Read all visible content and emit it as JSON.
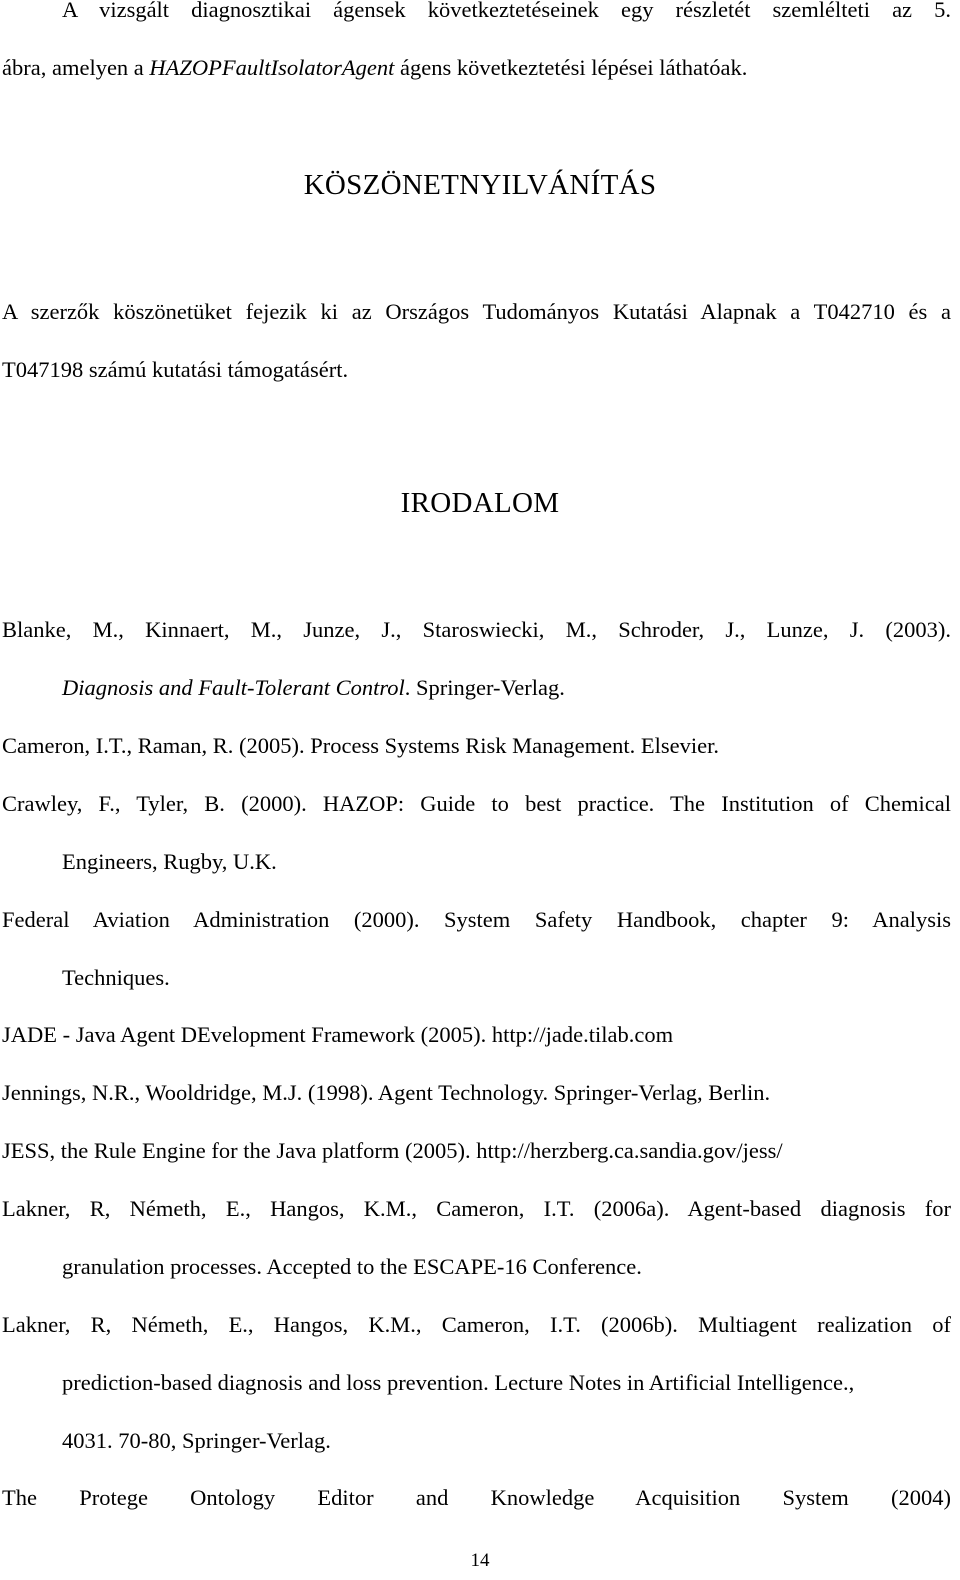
{
  "intro": {
    "line1": "A vizsgált diagnosztikai ágensek következtetéseinek egy részletét szemlélteti az 5.",
    "line2_before": "ábra, amelyen a ",
    "line2_italic": "HAZOPFaultIsolatorAgent",
    "line2_after": " ágens következtetési lépései láthatóak."
  },
  "acknowledgement": {
    "heading": "KÖSZÖNETNYILVÁNÍTÁS",
    "line1": "A szerzők köszönetüket fejezik ki az Országos Tudományos Kutatási Alapnak a T042710 és a",
    "line2": "T047198 számú kutatási támogatásért."
  },
  "references": {
    "heading": "IRODALOM",
    "items": [
      {
        "line1": "Blanke, M., Kinnaert, M., Junze, J., Staroswiecki, M., Schroder, J., Lunze, J. (2003).",
        "line2_italic": "Diagnosis and Fault-Tolerant Control",
        "line2_after": ". Springer-Verlag."
      },
      {
        "line1": "Cameron, I.T., Raman, R. (2005). Process Systems Risk Management. Elsevier."
      },
      {
        "line1": "Crawley, F., Tyler, B. (2000). HAZOP: Guide to best practice. The Institution of Chemical",
        "line2": "Engineers, Rugby, U.K."
      },
      {
        "line1": "Federal Aviation Administration (2000). System Safety Handbook, chapter 9: Analysis",
        "line2": "Techniques."
      },
      {
        "line1": "JADE - Java Agent DEvelopment Framework (2005). http://jade.tilab.com"
      },
      {
        "line1": "Jennings, N.R., Wooldridge, M.J. (1998). Agent Technology. Springer-Verlag, Berlin."
      },
      {
        "line1": "JESS, the Rule Engine for the Java platform (2005). http://herzberg.ca.sandia.gov/jess/"
      },
      {
        "line1": "Lakner, R, Németh, E., Hangos, K.M., Cameron, I.T. (2006a). Agent-based diagnosis for",
        "line2": "granulation processes. Accepted to the ESCAPE-16 Conference."
      },
      {
        "line1": "Lakner, R, Németh, E., Hangos, K.M., Cameron, I.T. (2006b). Multiagent realization of",
        "line2": "prediction-based diagnosis and loss prevention. Lecture Notes in Artificial Intelligence.,",
        "line3": "4031. 70-80, Springer-Verlag."
      },
      {
        "line1": "The Protege Ontology Editor and Knowledge Acquisition System (2004)"
      }
    ]
  },
  "page_number": "14"
}
